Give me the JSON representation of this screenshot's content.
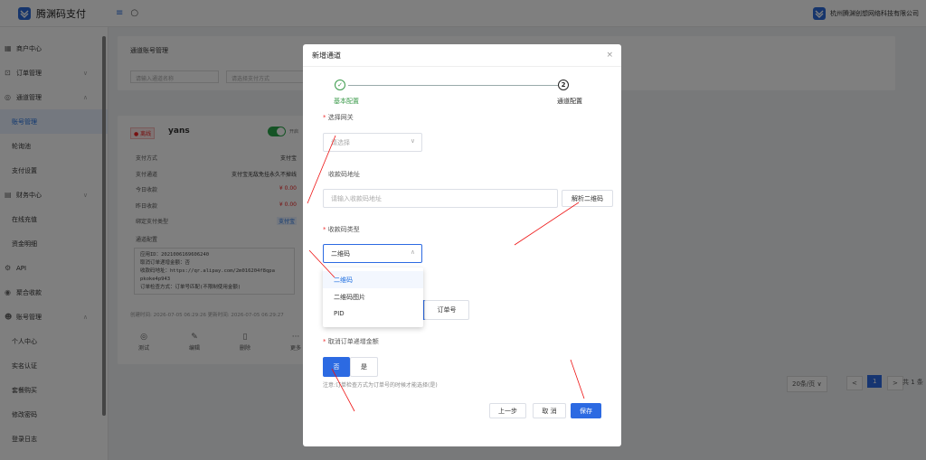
{
  "header": {
    "brand": "腾渊码支付",
    "company": "杭州腾渊创想网络科技有限公司"
  },
  "sidebar": {
    "items": [
      {
        "label": "商户中心",
        "icon": "grid-icon",
        "chev": ""
      },
      {
        "label": "订单管理",
        "icon": "cart-icon",
        "chev": "∨"
      },
      {
        "label": "通道管理",
        "icon": "globe-icon",
        "chev": "∧"
      },
      {
        "label": "账号管理",
        "icon": "",
        "chev": ""
      },
      {
        "label": "轮询池",
        "icon": "",
        "chev": ""
      },
      {
        "label": "支付设置",
        "icon": "",
        "chev": ""
      },
      {
        "label": "财务中心",
        "icon": "wallet-icon",
        "chev": "∨"
      },
      {
        "label": "在线充值",
        "icon": "",
        "chev": ""
      },
      {
        "label": "资金明细",
        "icon": "",
        "chev": ""
      },
      {
        "label": "API",
        "icon": "gear-icon",
        "chev": ""
      },
      {
        "label": "聚合收款",
        "icon": "user-icon",
        "chev": ""
      },
      {
        "label": "账号管理",
        "icon": "person-icon",
        "chev": "∧"
      },
      {
        "label": "个人中心",
        "icon": "",
        "chev": ""
      },
      {
        "label": "实名认证",
        "icon": "",
        "chev": ""
      },
      {
        "label": "套餐购买",
        "icon": "",
        "chev": ""
      },
      {
        "label": "修改密码",
        "icon": "",
        "chev": ""
      },
      {
        "label": "登录日志",
        "icon": "",
        "chev": ""
      }
    ]
  },
  "page": {
    "title": "通道账号管理",
    "search_name_placeholder": "请输入通道名称",
    "search_pay_placeholder": "请选择支付方式"
  },
  "account_card": {
    "status": "离线",
    "name": "yans",
    "toggle_label": "开启",
    "rows": [
      {
        "label": "支付方式",
        "value": "支付宝"
      },
      {
        "label": "支付通道",
        "value": "支付宝无敌免挂永久不掉线"
      },
      {
        "label": "今日收款",
        "value": "¥ 0.00"
      },
      {
        "label": "昨日收款",
        "value": "¥ 0.00"
      },
      {
        "label": "绑定支付类型",
        "value": "支付宝"
      }
    ],
    "config_title": "通道配置",
    "config_lines": [
      "应用ID：2021006169606240",
      "取消订单递增金额：否",
      "收款码地址：https://qr.alipay.com/2m016204f8qpa",
      "pkoke4p943",
      "订单检查方式：订单号匹配(不限制使用金额)"
    ],
    "timestamps": "创建时间: 2026-07-05 06:29:26 更新时间: 2026-07-05 06:29:27",
    "actions": [
      {
        "label": "测试",
        "icon": "play-icon"
      },
      {
        "label": "编辑",
        "icon": "edit-icon"
      },
      {
        "label": "删除",
        "icon": "trash-icon"
      },
      {
        "label": "更多",
        "icon": "more-icon"
      }
    ]
  },
  "pagination": {
    "size": "20条/页",
    "current": "1",
    "total": "共 1 条"
  },
  "modal": {
    "title": "新增通道",
    "steps": [
      {
        "label": "基本配置",
        "mark": "✓"
      },
      {
        "label": "通道配置",
        "mark": "2"
      }
    ],
    "gateway_label": "选择网关",
    "gateway_placeholder": "请选择",
    "qr_label": "收款码地址",
    "qr_placeholder": "请输入收款码地址",
    "parse_button": "解析二维码",
    "qr_type_label": "收款码类型",
    "qr_type_value": "二维码",
    "qr_type_options": [
      "二维码",
      "二维码图片",
      "PID"
    ],
    "check_option_order": "订单号",
    "cancel_incr_label": "取消订单递增金额",
    "no_label": "否",
    "yes_label": "是",
    "note": "注意:订单检查方式为订单号的时候才能选择(是)",
    "prev_button": "上一步",
    "cancel_button": "取 消",
    "save_button": "保存"
  }
}
